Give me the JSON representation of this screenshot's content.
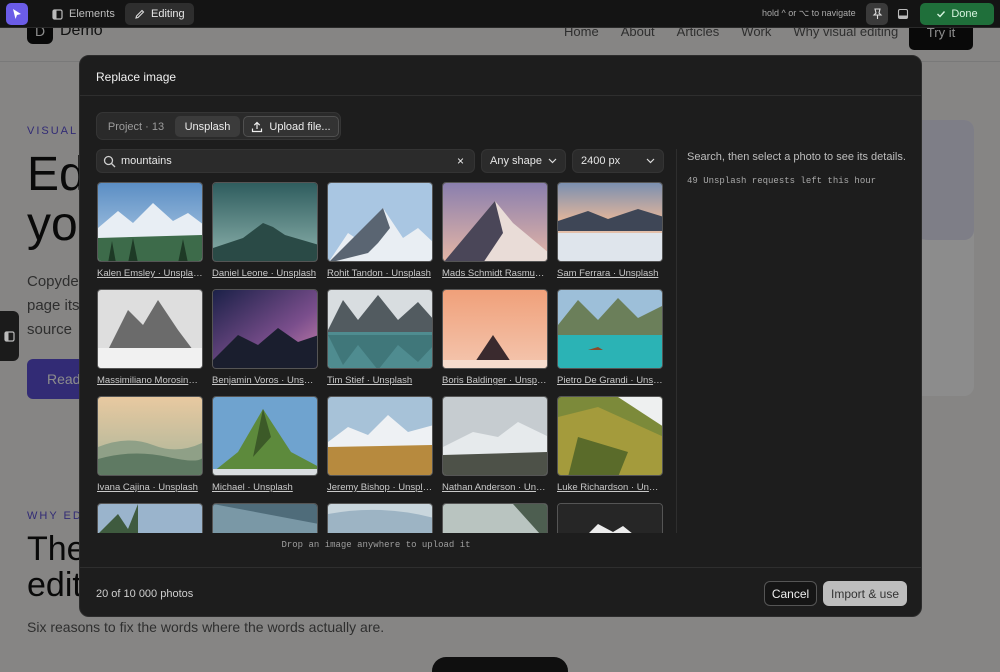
{
  "background_page": {
    "logo_letter": "D",
    "brand": "Demo",
    "nav": [
      "Home",
      "About",
      "Articles",
      "Work",
      "Why visual editing"
    ],
    "cta": "Try it",
    "eyebrow1": "VISUAL E",
    "hero_line1": "Ed",
    "hero_line2": "yo",
    "para_line1": "Copyde",
    "para_line2": "page its",
    "para_line3": "source",
    "button": "Read",
    "eyebrow2": "WHY EDIT",
    "h2_line1": "The",
    "h2_line2": "edit",
    "subtitle": "Six reasons to fix the words where the words actually are."
  },
  "toolbar": {
    "elements_label": "Elements",
    "editing_label": "Editing",
    "hint": "hold ^ or ⌥ to navigate",
    "done_label": "Done"
  },
  "modal": {
    "title": "Replace image",
    "sources": {
      "project": "Project · 13",
      "unsplash": "Unsplash",
      "upload": "Upload file..."
    },
    "search": {
      "query": "mountains",
      "clear_icon": "×"
    },
    "shape_select": "Any shape",
    "size_select": "2400 px",
    "details_hint": "Search, then select a photo to see its details.",
    "requests_left": "49 Unsplash requests left this hour",
    "drop_hint": "Drop an image anywhere to upload it",
    "result_count": "20 of 10 000 photos",
    "cancel_label": "Cancel",
    "import_label": "Import & use",
    "photos": [
      {
        "credit": "Kalen Emsley · Unsplash"
      },
      {
        "credit": "Daniel Leone · Unsplash"
      },
      {
        "credit": "Rohit Tandon · Unsplash"
      },
      {
        "credit": "Mads Schmidt Rasmussen · Unsplash"
      },
      {
        "credit": "Sam Ferrara · Unsplash"
      },
      {
        "credit": "Massimiliano Morosinotto · Unsplash"
      },
      {
        "credit": "Benjamin Voros · Unsplash"
      },
      {
        "credit": "Tim Stief · Unsplash"
      },
      {
        "credit": "Boris Baldinger · Unsplash"
      },
      {
        "credit": "Pietro De Grandi · Unsplash"
      },
      {
        "credit": "Ivana Cajina · Unsplash"
      },
      {
        "credit": "Michael · Unsplash"
      },
      {
        "credit": "Jeremy Bishop · Unsplash"
      },
      {
        "credit": "Nathan Anderson · Unsplash"
      },
      {
        "credit": "Luke Richardson · Unsplash"
      },
      {
        "credit": ""
      },
      {
        "credit": ""
      },
      {
        "credit": ""
      },
      {
        "credit": ""
      },
      {
        "credit": ""
      }
    ]
  }
}
